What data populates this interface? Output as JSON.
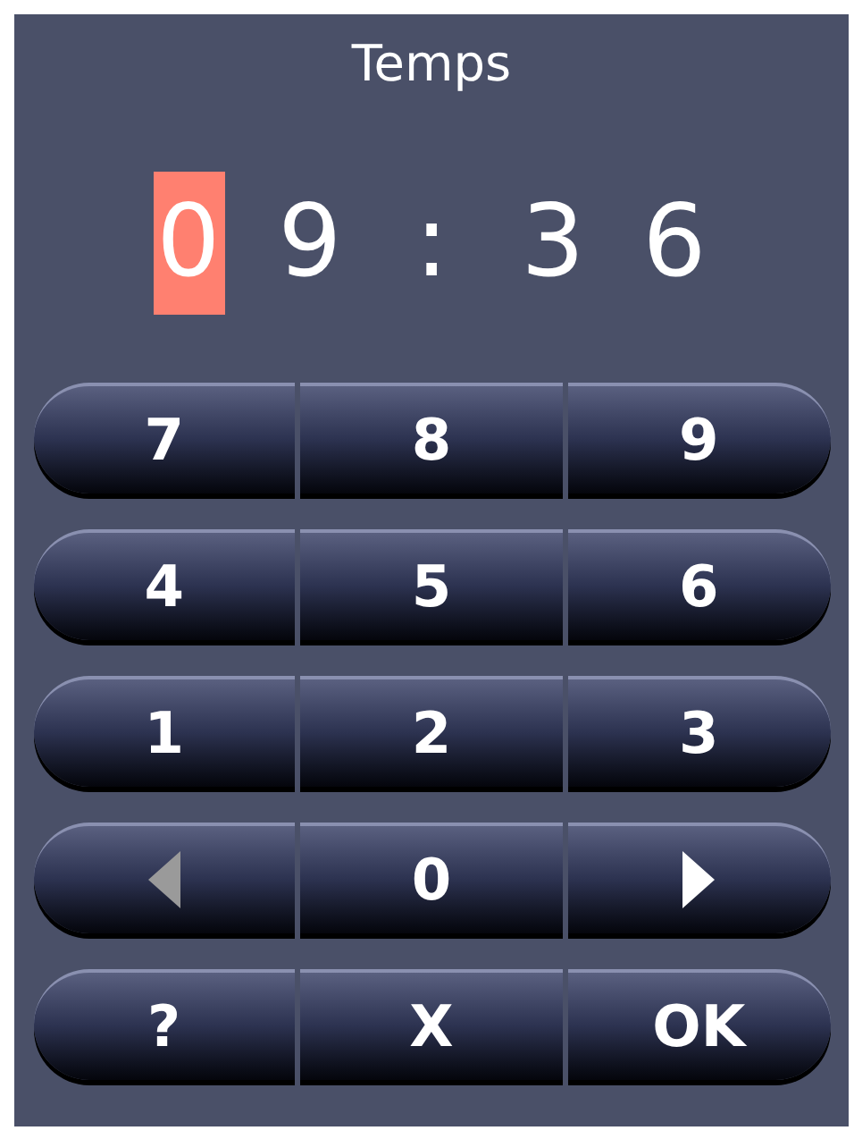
{
  "title": "Temps",
  "time": [
    {
      "char": "0",
      "selected": true
    },
    {
      "char": "9",
      "selected": false
    },
    {
      "char": ":",
      "selected": false
    },
    {
      "char": "3",
      "selected": false
    },
    {
      "char": "6",
      "selected": false
    }
  ],
  "keypad": [
    [
      {
        "kind": "text",
        "label": "7"
      },
      {
        "kind": "text",
        "label": "8"
      },
      {
        "kind": "text",
        "label": "9"
      }
    ],
    [
      {
        "kind": "text",
        "label": "4"
      },
      {
        "kind": "text",
        "label": "5"
      },
      {
        "kind": "text",
        "label": "6"
      }
    ],
    [
      {
        "kind": "text",
        "label": "1"
      },
      {
        "kind": "text",
        "label": "2"
      },
      {
        "kind": "text",
        "label": "3"
      }
    ],
    [
      {
        "kind": "arrow-left",
        "disabled": true
      },
      {
        "kind": "text",
        "label": "0"
      },
      {
        "kind": "arrow-right",
        "disabled": false
      }
    ],
    [
      {
        "kind": "text",
        "label": "?"
      },
      {
        "kind": "text",
        "label": "X"
      },
      {
        "kind": "text",
        "label": "OK"
      }
    ]
  ]
}
